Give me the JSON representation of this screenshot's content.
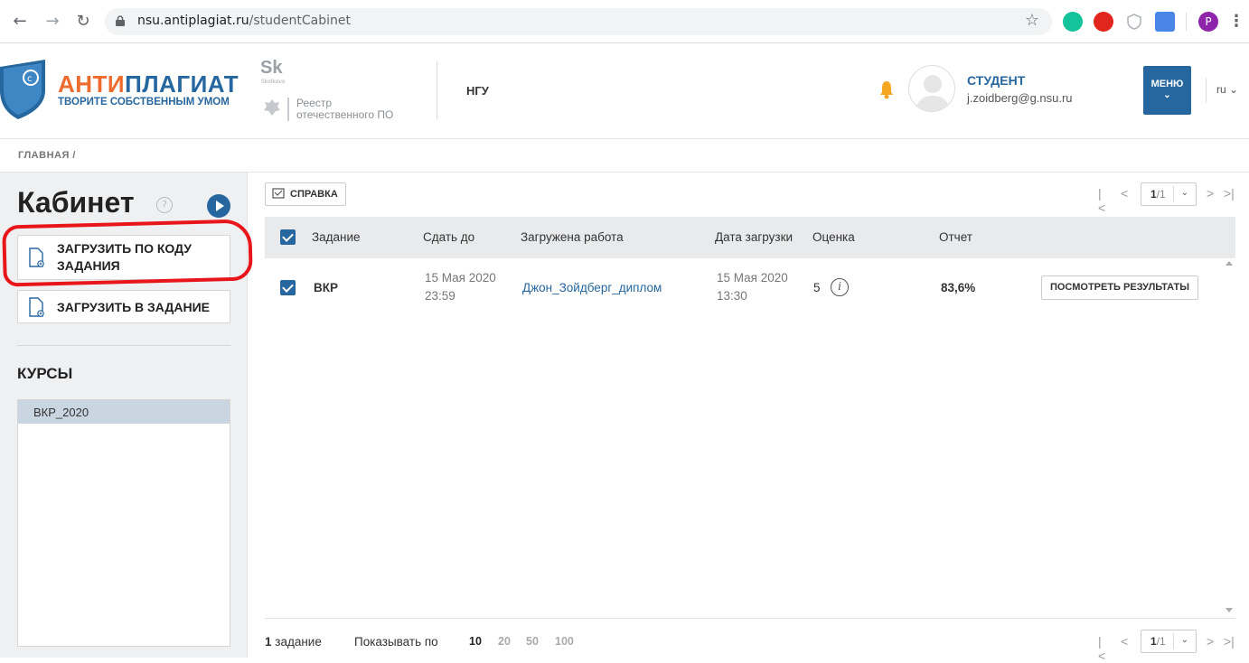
{
  "browser": {
    "url_host": "nsu.antiplagiat.ru",
    "url_path": "/studentCabinet",
    "extensions": [
      {
        "name": "grammarly-icon",
        "color": "#15c39a"
      },
      {
        "name": "adblock-icon",
        "color": "#e2261d"
      },
      {
        "name": "shield-ext-icon",
        "color": "#b0b4ba"
      },
      {
        "name": "translate-icon",
        "color": "#4a86e8"
      },
      {
        "name": "profile-avatar",
        "color": "#8e24aa",
        "letter": "P"
      }
    ]
  },
  "header": {
    "brand_part1": "АНТИ",
    "brand_part2": "ПЛАГИАТ",
    "slogan": "ТВОРИТЕ СОБСТВЕННЫМ УМОМ",
    "sk_logo": "Sk",
    "skolkovo": "Skolkovo",
    "registry_line1": "Реестр",
    "registry_line2": "отечественного ПО",
    "org": "НГУ",
    "user_role": "СТУДЕНТ",
    "user_email": "j.zoidberg@g.nsu.ru",
    "menu_label": "МЕНЮ",
    "lang": "ru",
    "colors": {
      "brand_orange": "#ee6b2e",
      "brand_blue": "#27679f",
      "bell": "#f5a623"
    }
  },
  "breadcrumb": "ГЛАВНАЯ /",
  "sidebar": {
    "title": "Кабинет",
    "help_symbol": "?",
    "upload_by_code_line1": "ЗАГРУЗИТЬ ПО КОДУ",
    "upload_by_code_line2": "ЗАДАНИЯ",
    "upload_to_task": "ЗАГРУЗИТЬ В ЗАДАНИЕ",
    "courses_heading": "КУРСЫ",
    "courses": [
      "ВКР_2020"
    ]
  },
  "main": {
    "help_button": "СПРАВКА",
    "pager": {
      "current": "1",
      "total": "/1"
    },
    "columns": [
      "Задание",
      "Сдать до",
      "Загружена работа",
      "Дата загрузки",
      "Оценка",
      "Отчет"
    ],
    "rows": [
      {
        "task": "ВКР",
        "due_date": "15 Мая 2020",
        "due_time": "23:59",
        "work": "Джон_Зойдберг_диплом",
        "upload_date": "15 Мая 2020",
        "upload_time": "13:30",
        "grade": "5",
        "report": "83,6%",
        "action": "ПОСМОТРЕТЬ РЕЗУЛЬТАТЫ"
      }
    ],
    "footer": {
      "count_num": "1",
      "count_label": " задание",
      "per_page_label": "Показывать по",
      "per_page_options": [
        "10",
        "20",
        "50",
        "100"
      ],
      "per_page_selected": "10"
    }
  }
}
